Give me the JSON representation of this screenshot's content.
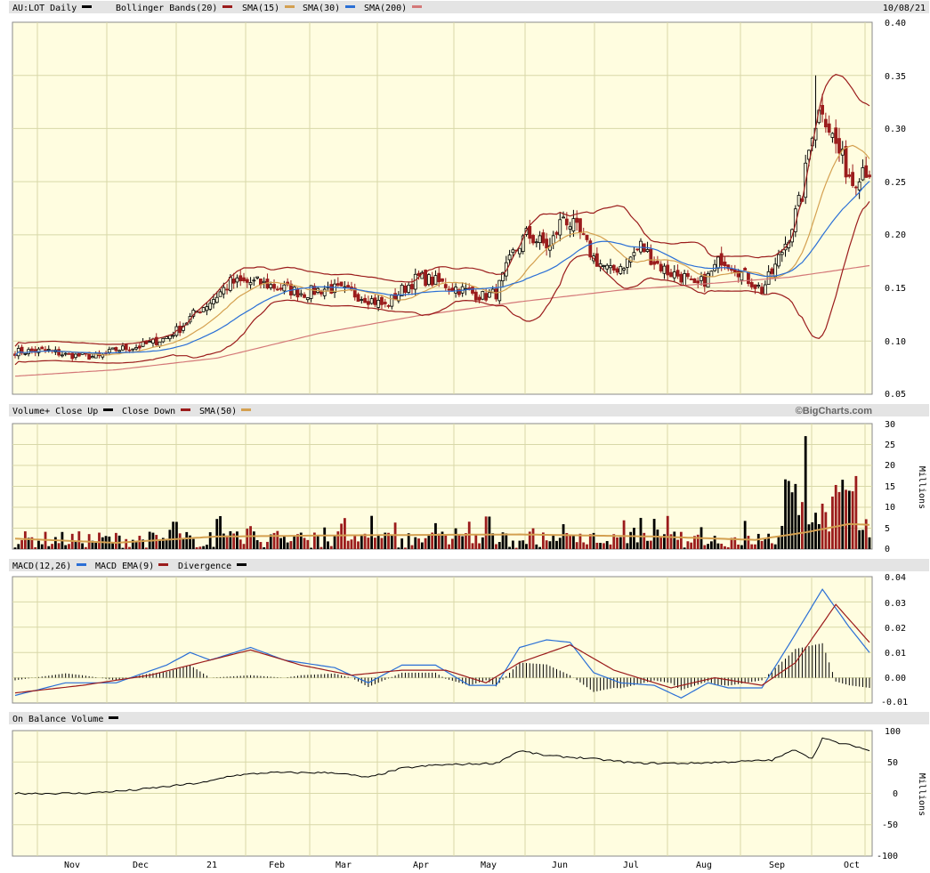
{
  "header": {
    "symbol_label": "AU:LOT Daily",
    "date": "10/08/21",
    "legend": [
      {
        "label": "Bollinger Bands(20)",
        "color": "#9b1c1c"
      },
      {
        "label": "SMA(15)",
        "color": "#d4a050"
      },
      {
        "label": "SMA(30)",
        "color": "#2a6fd6"
      },
      {
        "label": "SMA(200)",
        "color": "#d47878"
      }
    ],
    "symbol_color": "#000000"
  },
  "volume_header": {
    "legend": [
      {
        "label": "Volume+ Close Up",
        "color": "#000000"
      },
      {
        "label": "Close Down",
        "color": "#9b1c1c"
      },
      {
        "label": "SMA(50)",
        "color": "#d4a050"
      }
    ],
    "brand": "©BigCharts.com",
    "unit": "Millions"
  },
  "macd_header": {
    "legend": [
      {
        "label": "MACD(12,26)",
        "color": "#2a6fd6"
      },
      {
        "label": "MACD EMA(9)",
        "color": "#9b1c1c"
      },
      {
        "label": "Divergence",
        "color": "#000000"
      }
    ]
  },
  "obv_header": {
    "legend": [
      {
        "label": "On Balance Volume",
        "color": "#000000"
      }
    ],
    "unit": "Millions"
  },
  "colors": {
    "panel_bg": "#fffde0",
    "grid": "#d8d8a8",
    "header_bg": "#e4e4e4",
    "up": "#000000",
    "down": "#9b1c1c",
    "bb": "#9b1c1c",
    "sma15": "#d4a050",
    "sma30": "#2a6fd6",
    "sma200": "#d47878",
    "vol_sma": "#d4a050",
    "macd": "#2a6fd6",
    "signal": "#9b1c1c"
  },
  "chart_data": [
    {
      "type": "candlestick",
      "panel": "price",
      "yticks": [
        "0.40",
        "0.35",
        "0.30",
        "0.25",
        "0.20",
        "0.15",
        "0.10",
        "0.05"
      ],
      "ylim": [
        0.05,
        0.4
      ],
      "xlabels": [
        "Nov",
        "Dec",
        "21",
        "Feb",
        "Mar",
        "Apr",
        "May",
        "Jun",
        "Jul",
        "Aug",
        "Sep",
        "Oct"
      ],
      "close_knots": [
        [
          0,
          0.09
        ],
        [
          10,
          0.091
        ],
        [
          15,
          0.087
        ],
        [
          25,
          0.085
        ],
        [
          30,
          0.092
        ],
        [
          37,
          0.095
        ],
        [
          44,
          0.102
        ],
        [
          49,
          0.112
        ],
        [
          54,
          0.128
        ],
        [
          58,
          0.137
        ],
        [
          64,
          0.155
        ],
        [
          72,
          0.155
        ],
        [
          79,
          0.15
        ],
        [
          86,
          0.145
        ],
        [
          93,
          0.15
        ],
        [
          99,
          0.146
        ],
        [
          105,
          0.14
        ],
        [
          110,
          0.133
        ],
        [
          115,
          0.148
        ],
        [
          120,
          0.16
        ],
        [
          126,
          0.155
        ],
        [
          133,
          0.148
        ],
        [
          139,
          0.142
        ],
        [
          143,
          0.145
        ],
        [
          148,
          0.182
        ],
        [
          152,
          0.2
        ],
        [
          159,
          0.188
        ],
        [
          163,
          0.218
        ],
        [
          168,
          0.2
        ],
        [
          172,
          0.178
        ],
        [
          177,
          0.165
        ],
        [
          182,
          0.175
        ],
        [
          186,
          0.19
        ],
        [
          190,
          0.175
        ],
        [
          194,
          0.165
        ],
        [
          199,
          0.16
        ],
        [
          202,
          0.15
        ],
        [
          206,
          0.16
        ],
        [
          210,
          0.178
        ],
        [
          214,
          0.17
        ],
        [
          218,
          0.158
        ],
        [
          222,
          0.148
        ],
        [
          226,
          0.17
        ],
        [
          230,
          0.2
        ],
        [
          234,
          0.238
        ],
        [
          237,
          0.3
        ],
        [
          240,
          0.322
        ],
        [
          243,
          0.292
        ],
        [
          246,
          0.27
        ],
        [
          249,
          0.25
        ],
        [
          252,
          0.265
        ],
        [
          254,
          0.26
        ]
      ],
      "spikes": [
        [
          238,
          0.35
        ]
      ],
      "sma200_knots": [
        [
          0,
          0.067
        ],
        [
          30,
          0.073
        ],
        [
          60,
          0.084
        ],
        [
          90,
          0.107
        ],
        [
          120,
          0.124
        ],
        [
          150,
          0.137
        ],
        [
          180,
          0.148
        ],
        [
          210,
          0.155
        ],
        [
          230,
          0.16
        ],
        [
          254,
          0.171
        ]
      ],
      "n_days": 255
    },
    {
      "type": "bar",
      "panel": "volume",
      "yticks": [
        "30",
        "25",
        "20",
        "15",
        "10",
        "5",
        "0"
      ],
      "ylim": [
        0,
        30
      ],
      "unit": "Millions",
      "notable": [
        {
          "label": "peak",
          "value": 27
        }
      ],
      "sma50_knots": [
        [
          0,
          2.5
        ],
        [
          30,
          1.5
        ],
        [
          60,
          3.0
        ],
        [
          100,
          3.3
        ],
        [
          150,
          3.5
        ],
        [
          190,
          3.0
        ],
        [
          220,
          2.2
        ],
        [
          235,
          4.0
        ],
        [
          248,
          6.0
        ],
        [
          254,
          5.8
        ]
      ]
    },
    {
      "type": "line",
      "panel": "macd",
      "yticks": [
        "0.04",
        "0.03",
        "0.02",
        "0.01",
        "0.00",
        "-0.01"
      ],
      "ylim": [
        -0.01,
        0.04
      ],
      "series": [
        {
          "name": "MACD(12,26)",
          "knots": [
            [
              0,
              -0.007
            ],
            [
              15,
              -0.002
            ],
            [
              30,
              -0.002
            ],
            [
              45,
              0.005
            ],
            [
              52,
              0.01
            ],
            [
              58,
              0.007
            ],
            [
              70,
              0.012
            ],
            [
              80,
              0.007
            ],
            [
              95,
              0.004
            ],
            [
              105,
              -0.002
            ],
            [
              115,
              0.005
            ],
            [
              125,
              0.005
            ],
            [
              135,
              -0.003
            ],
            [
              143,
              -0.003
            ],
            [
              150,
              0.012
            ],
            [
              158,
              0.015
            ],
            [
              165,
              0.014
            ],
            [
              172,
              0.002
            ],
            [
              180,
              -0.002
            ],
            [
              190,
              -0.003
            ],
            [
              198,
              -0.008
            ],
            [
              206,
              -0.002
            ],
            [
              212,
              -0.004
            ],
            [
              222,
              -0.004
            ],
            [
              230,
              0.013
            ],
            [
              240,
              0.035
            ],
            [
              248,
              0.02
            ],
            [
              254,
              0.01
            ]
          ]
        },
        {
          "name": "MACD EMA(9)",
          "knots": [
            [
              0,
              -0.006
            ],
            [
              20,
              -0.003
            ],
            [
              40,
              0.001
            ],
            [
              55,
              0.006
            ],
            [
              70,
              0.011
            ],
            [
              85,
              0.005
            ],
            [
              100,
              0.001
            ],
            [
              115,
              0.003
            ],
            [
              128,
              0.003
            ],
            [
              140,
              -0.002
            ],
            [
              150,
              0.006
            ],
            [
              165,
              0.013
            ],
            [
              178,
              0.003
            ],
            [
              195,
              -0.004
            ],
            [
              208,
              0.0
            ],
            [
              222,
              -0.003
            ],
            [
              232,
              0.006
            ],
            [
              244,
              0.029
            ],
            [
              254,
              0.014
            ]
          ]
        }
      ]
    },
    {
      "type": "line",
      "panel": "obv",
      "yticks": [
        "100",
        "50",
        "0",
        "-50",
        "-100"
      ],
      "ylim": [
        -100,
        100
      ],
      "unit": "Millions",
      "series": [
        {
          "name": "On Balance Volume",
          "knots": [
            [
              0,
              0
            ],
            [
              20,
              0
            ],
            [
              35,
              5
            ],
            [
              47,
              12
            ],
            [
              57,
              18
            ],
            [
              64,
              28
            ],
            [
              75,
              33
            ],
            [
              95,
              33
            ],
            [
              105,
              25
            ],
            [
              115,
              40
            ],
            [
              125,
              45
            ],
            [
              143,
              48
            ],
            [
              150,
              68
            ],
            [
              158,
              60
            ],
            [
              170,
              56
            ],
            [
              185,
              48
            ],
            [
              200,
              48
            ],
            [
              212,
              50
            ],
            [
              225,
              53
            ],
            [
              232,
              70
            ],
            [
              237,
              55
            ],
            [
              240,
              88
            ],
            [
              245,
              80
            ],
            [
              250,
              75
            ],
            [
              254,
              68
            ]
          ]
        }
      ]
    }
  ]
}
